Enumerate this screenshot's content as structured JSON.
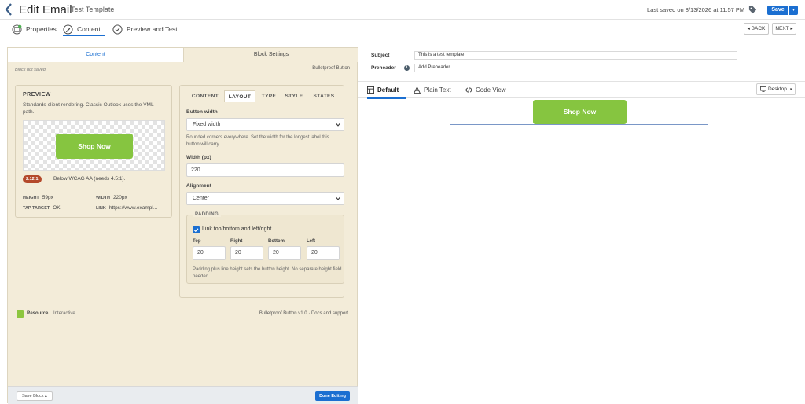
{
  "header": {
    "title": "Edit Email",
    "template_name": "Test Template",
    "last_saved": "Last saved on 8/13/2026 at 11:57 PM",
    "save_label": "Save",
    "save_drop": "▾"
  },
  "steps": [
    {
      "label": "Properties",
      "icon": "properties-icon"
    },
    {
      "label": "Content",
      "icon": "pencil-icon"
    },
    {
      "label": "Preview and Test",
      "icon": "check-circle-icon"
    }
  ],
  "nav": {
    "back": "◂ BACK",
    "next": "NEXT ▸"
  },
  "left": {
    "tabs": {
      "content": "Content",
      "block_settings": "Block Settings"
    },
    "block_status": "Block not saved",
    "block_type": "Bulletproof Button",
    "preview": {
      "heading": "PREVIEW",
      "description": "Standards-client rendering. Classic Outlook uses the VML path.",
      "button_text": "Shop Now",
      "ratio": "2.12:1",
      "ratio_note": "Below WCAG AA (needs 4.5:1).",
      "stats": {
        "height_k": "HEIGHT",
        "height_v": "59px",
        "width_k": "WIDTH",
        "width_v": "220px",
        "tap_k": "TAP TARGET",
        "tap_v": "OK",
        "link_k": "LINK",
        "link_v": "https://www.exampl..."
      }
    },
    "settings": {
      "tabs": [
        "CONTENT",
        "LAYOUT",
        "TYPE",
        "STYLE",
        "STATES"
      ],
      "active_tab": "LAYOUT",
      "button_width_label": "Button width",
      "button_width_value": "Fixed width",
      "button_width_hint": "Rounded corners everywhere. Set the width for the longest label this button will carry.",
      "width_label": "Width (px)",
      "width_value": "220",
      "alignment_label": "Alignment",
      "alignment_value": "Center",
      "padding": {
        "heading": "PADDING",
        "link_label": "Link top/bottom and left/right",
        "link_checked": true,
        "top_label": "Top",
        "top": "20",
        "right_label": "Right",
        "right": "20",
        "bottom_label": "Bottom",
        "bottom": "20",
        "left_label": "Left",
        "left": "20",
        "hint": "Padding plus line height sets the button height. No separate height field needed."
      }
    },
    "resource": {
      "label": "Resource",
      "type": "Interactive",
      "credit": "Bulletproof Button v1.0 · Docs and support"
    },
    "footer": {
      "save_block": "Save Block ▴",
      "done": "Done Editing"
    }
  },
  "right": {
    "subject_label": "Subject",
    "subject_value": "This is a test template",
    "preheader_label": "Preheader",
    "preheader_value": "Add Preheader",
    "view_tabs": [
      "Default",
      "Plain Text",
      "Code View"
    ],
    "device": "Desktop",
    "canvas_button": "Shop Now"
  },
  "colors": {
    "accent": "#1b6fd1",
    "button_green": "#86c540",
    "panel_bg": "#f3ecd9",
    "ratio_badge": "#b4492b"
  }
}
